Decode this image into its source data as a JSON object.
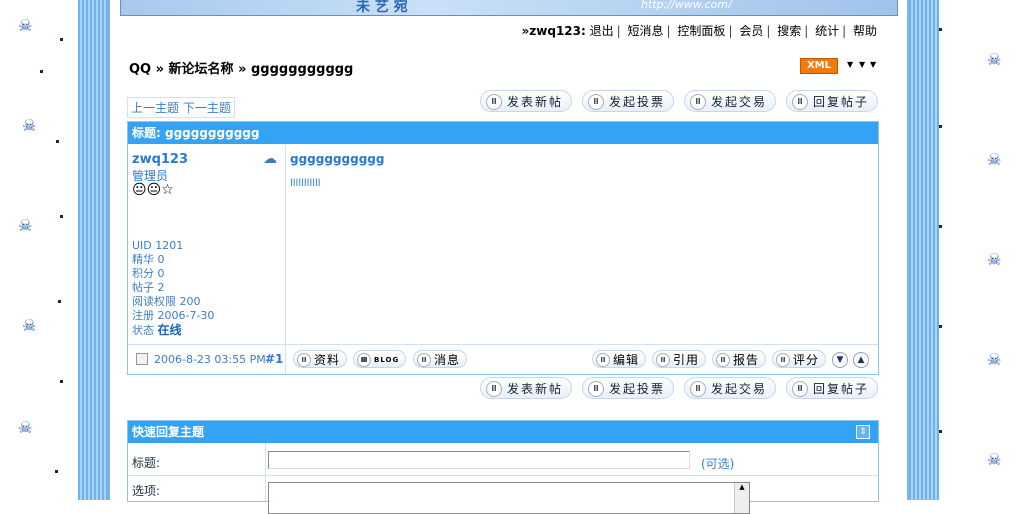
{
  "banner": {
    "text": "未 艺 宛",
    "url": "http://www.com/"
  },
  "topnav": {
    "prefix": "»",
    "user": "zwq123:",
    "items": [
      "退出",
      "短消息",
      "控制面板",
      "会员",
      "搜索",
      "统计",
      "帮助"
    ]
  },
  "breadcrumb": {
    "text": "QQ » 新论坛名称 » ggggggggggg"
  },
  "xml_badge": "XML",
  "prevnext": {
    "prev": "上一主题",
    "next": "下一主题"
  },
  "actions": {
    "new_thread": "发表新帖",
    "new_poll": "发起投票",
    "new_trade": "发起交易",
    "reply": "回复帖子"
  },
  "post": {
    "title_label": "标题: ggggggggggg",
    "author": {
      "name": "zwq123",
      "role": "管理员",
      "smilies": "😐😐☆"
    },
    "stats": {
      "uid": "UID 1201",
      "digest": "精华 0",
      "credits": "积分 0",
      "posts": "帖子 2",
      "readperm": "阅读权限 200",
      "regdate": "注册 2006-7-30",
      "status_label": "状态",
      "status_value": "在线"
    },
    "subject": "ggggggggggg",
    "body": "lllllllllll",
    "date": "2006-8-23 03:55 PM",
    "floor": "#1",
    "left_buttons": {
      "profile": "资料",
      "blog": "BLOG",
      "message": "消息"
    },
    "right_buttons": {
      "edit": "编辑",
      "quote": "引用",
      "report": "报告",
      "rate": "评分"
    }
  },
  "quick_reply": {
    "title": "快速回复主题",
    "subject_label": "标题:",
    "optional": "(可选)",
    "options_label": "选项:"
  }
}
